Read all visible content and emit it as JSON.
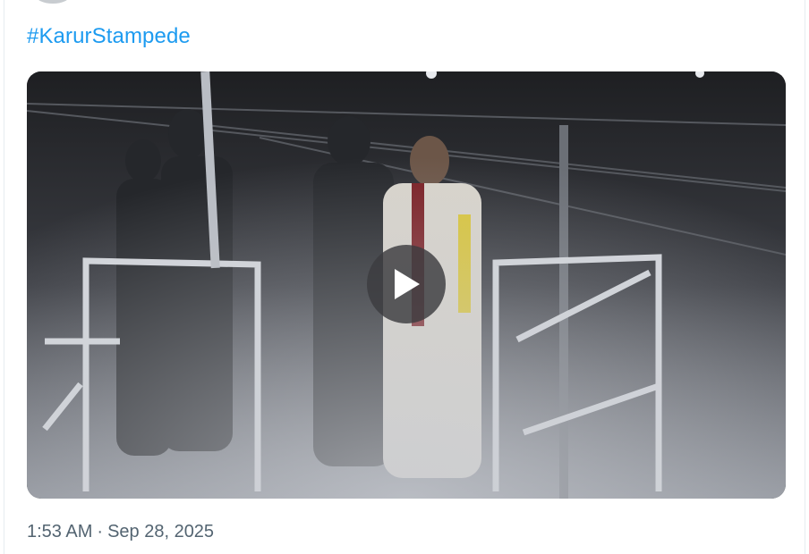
{
  "tweet": {
    "hashtag": "#KarurStampede",
    "time": "1:53 AM",
    "separator": "·",
    "date": "Sep 28, 2025"
  },
  "media": {
    "type": "video",
    "play_icon": "play-icon"
  },
  "colors": {
    "hashtag": "#1d9bf0",
    "muted_text": "#536471",
    "play_overlay": "#3c3c40"
  }
}
